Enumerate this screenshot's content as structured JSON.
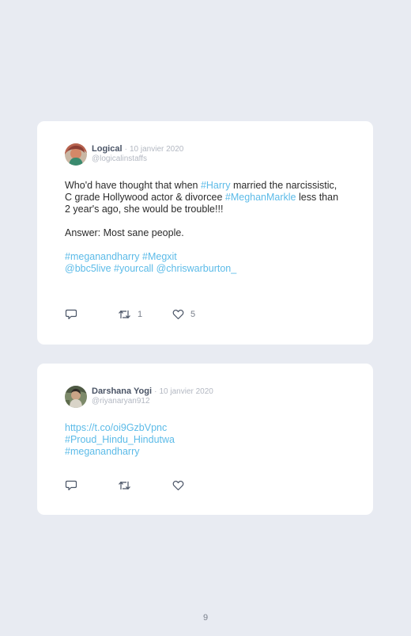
{
  "tweets": [
    {
      "author": "Logical",
      "separator": "·",
      "date": "10 janvier 2020",
      "handle": "@logicalinstaffs",
      "avatar_icon": "avatar-photo-icon",
      "body": {
        "p1": [
          {
            "type": "text",
            "value": "Who'd have thought that when "
          },
          {
            "type": "tag",
            "value": "#Harry"
          },
          {
            "type": "text",
            "value": " married the narcissistic, C grade Hollywood actor & divorcee "
          },
          {
            "type": "tag",
            "value": "#MeghanMarkle"
          },
          {
            "type": "text",
            "value": " less than 2 year's ago, she would be trouble!!!"
          }
        ],
        "p2": "Answer: Most sane people.",
        "tags_line1": [
          "#meganandharry",
          "#Megxit"
        ],
        "tags_line2": [
          "@bbc5live",
          "#yourcall",
          "@chriswarburton_"
        ]
      },
      "actions": {
        "reply_icon": "reply-icon",
        "retweet_icon": "retweet-icon",
        "like_icon": "heart-icon",
        "retweet_count": "1",
        "like_count": "5"
      }
    },
    {
      "author": "Darshana Yogi",
      "separator": "·",
      "date": "10 janvier 2020",
      "handle": "@riyanaryan912",
      "avatar_icon": "avatar-photo-icon",
      "body": {
        "lines": [
          "https://t.co/oi9GzbVpnc",
          "#Proud_Hindu_Hindutwa",
          "#meganandharry"
        ]
      },
      "actions": {
        "reply_icon": "reply-icon",
        "retweet_icon": "retweet-icon",
        "like_icon": "heart-icon",
        "retweet_count": "",
        "like_count": ""
      }
    }
  ],
  "page_number": "9",
  "colors": {
    "background": "#e8ebf2",
    "card": "#ffffff",
    "link": "#5cbbe8",
    "text": "#2b2b2b",
    "muted": "#b3b8c2"
  }
}
